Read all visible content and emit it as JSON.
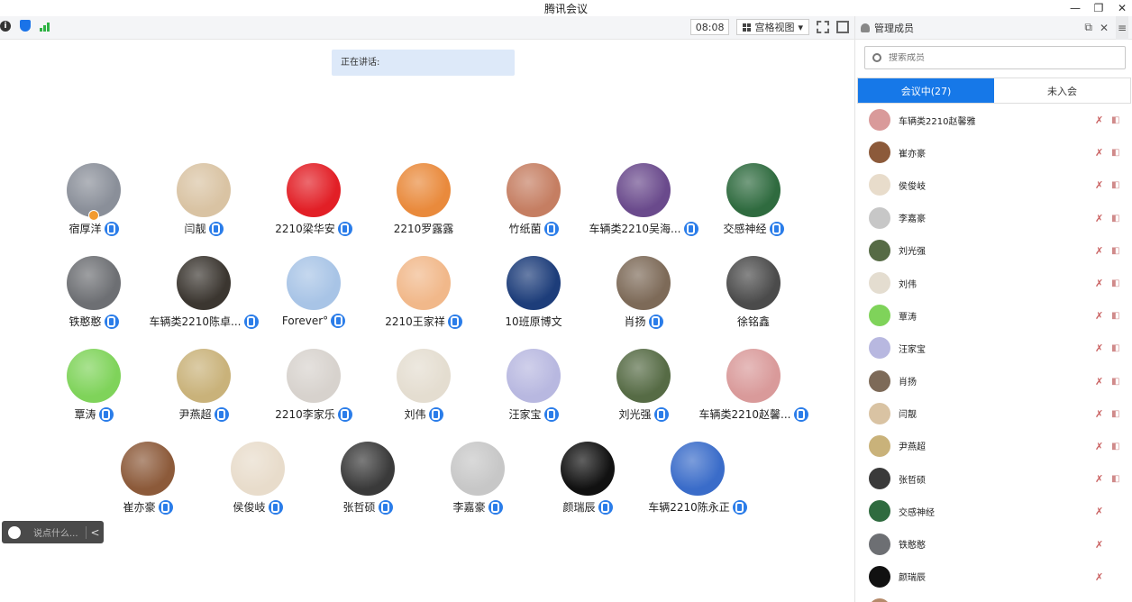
{
  "window": {
    "title": "腾讯会议",
    "min": "—",
    "restore": "❐",
    "close": "✕"
  },
  "toolbar": {
    "info_icon": "i",
    "timer": "08:08",
    "view_label": "宫格视图",
    "view_caret": "▾"
  },
  "speaking_label": "正在讲话:",
  "participants": [
    {
      "name": "宿厚洋",
      "color": "#8a8f99",
      "mic": true,
      "host": true
    },
    {
      "name": "闫靓",
      "color": "#d9c3a3",
      "mic": true
    },
    {
      "name": "2210梁华安",
      "color": "#e21f26",
      "mic": true
    },
    {
      "name": "2210罗露露",
      "color": "#e98a3c",
      "mic": false
    },
    {
      "name": "竹纸菌",
      "color": "#c57e62",
      "mic": true
    },
    {
      "name": "车辆类2210吴海...",
      "color": "#6a4a8c",
      "mic": true
    },
    {
      "name": "交感神经",
      "color": "#2f6b3f",
      "mic": true
    },
    {
      "name": "铁憨憨",
      "color": "#6d6f73",
      "mic": true
    },
    {
      "name": "车辆类2210陈卓...",
      "color": "#3b3630",
      "mic": true
    },
    {
      "name": "Forever°",
      "color": "#a8c4e6",
      "mic": true
    },
    {
      "name": "2210王家祥",
      "color": "#f1b88a",
      "mic": true
    },
    {
      "name": "10班原博文",
      "color": "#1d3d7a",
      "mic": false
    },
    {
      "name": "肖扬",
      "color": "#7d6a58",
      "mic": true
    },
    {
      "name": "徐铭鑫",
      "color": "#4b4b4b",
      "mic": false
    },
    {
      "name": "覃涛",
      "color": "#7fd35a",
      "mic": true
    },
    {
      "name": "尹燕超",
      "color": "#c9b27a",
      "mic": true
    },
    {
      "name": "2210李家乐",
      "color": "#d7d2cd",
      "mic": true
    },
    {
      "name": "刘伟",
      "color": "#e4ddd0",
      "mic": true
    },
    {
      "name": "汪家宝",
      "color": "#b8b8e0",
      "mic": true
    },
    {
      "name": "刘光强",
      "color": "#566b45",
      "mic": true
    },
    {
      "name": "车辆类2210赵馨...",
      "color": "#d99a9a",
      "mic": true
    },
    {
      "name": "崔亦豪",
      "color": "#8c5a3a",
      "mic": true
    },
    {
      "name": "侯俊岐",
      "color": "#e8dccb",
      "mic": true
    },
    {
      "name": "张哲硕",
      "color": "#3a3a3a",
      "mic": true
    },
    {
      "name": "李嘉豪",
      "color": "#c7c7c7",
      "mic": true
    },
    {
      "name": "颜瑞辰",
      "color": "#111111",
      "mic": true
    },
    {
      "name": "车辆2210陈永正",
      "color": "#3a6cc9",
      "mic": true
    }
  ],
  "chat": {
    "placeholder": "说点什么...",
    "chevron": "<"
  },
  "panel": {
    "title": "管理成员",
    "popout_icon": "⧉",
    "close_icon": "✕",
    "menu_icon": "≡",
    "search_placeholder": "搜索成员",
    "tab_in": "会议中(27)",
    "tab_out": "未入会",
    "mic_off_icon": "✗",
    "cam_off_icon": "◧"
  },
  "members": [
    {
      "name": "车辆类2210赵馨雅",
      "color": "#d99a9a",
      "cam": true
    },
    {
      "name": "崔亦豪",
      "color": "#8c5a3a",
      "cam": true
    },
    {
      "name": "侯俊岐",
      "color": "#e8dccb",
      "cam": true
    },
    {
      "name": "李嘉豪",
      "color": "#c7c7c7",
      "cam": true
    },
    {
      "name": "刘光强",
      "color": "#566b45",
      "cam": true
    },
    {
      "name": "刘伟",
      "color": "#e4ddd0",
      "cam": true
    },
    {
      "name": "覃涛",
      "color": "#7fd35a",
      "cam": true
    },
    {
      "name": "汪家宝",
      "color": "#b8b8e0",
      "cam": true
    },
    {
      "name": "肖扬",
      "color": "#7d6a58",
      "cam": true
    },
    {
      "name": "闫靓",
      "color": "#d9c3a3",
      "cam": true
    },
    {
      "name": "尹燕超",
      "color": "#c9b27a",
      "cam": true
    },
    {
      "name": "张哲硕",
      "color": "#3a3a3a",
      "cam": true
    },
    {
      "name": "交感神经",
      "color": "#2f6b3f",
      "cam": false
    },
    {
      "name": "铁憨憨",
      "color": "#6d6f73",
      "cam": false
    },
    {
      "name": "颜瑞辰",
      "color": "#111111",
      "cam": false
    },
    {
      "name": "",
      "color": "#b58a6a",
      "cam": false
    }
  ]
}
